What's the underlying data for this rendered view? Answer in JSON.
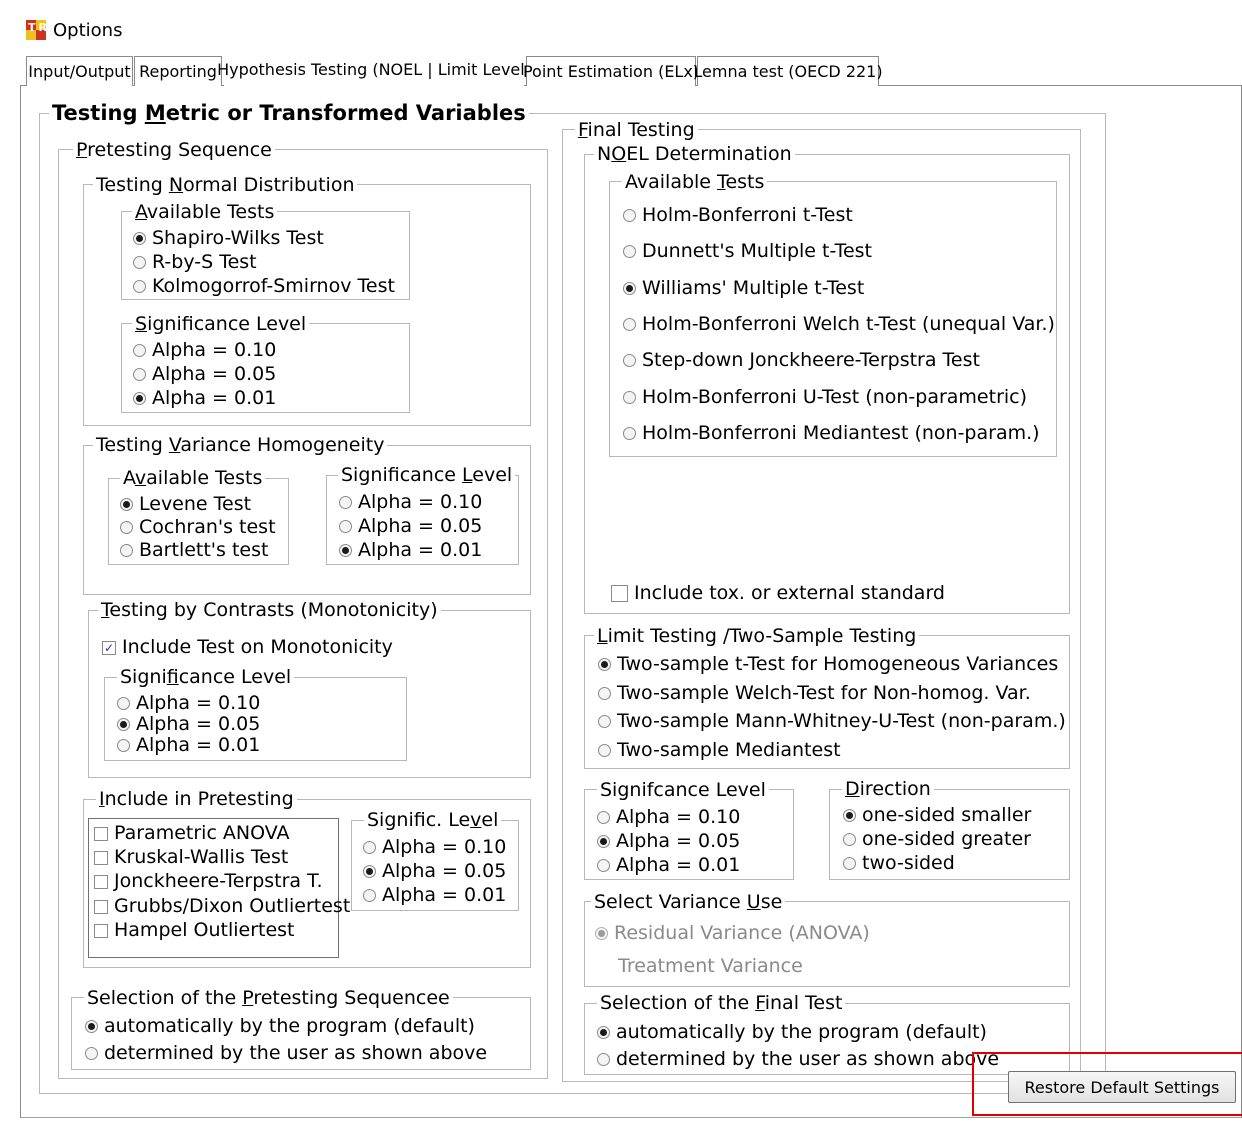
{
  "window": {
    "title": "Options",
    "logo_text": "TR"
  },
  "tabs": [
    {
      "label": "Input/Output",
      "active": false
    },
    {
      "label": "Reporting",
      "active": false
    },
    {
      "label": "Hypothesis Testing (NOEL | Limit Level)",
      "active": true
    },
    {
      "label": "Point Estimation (ELx)",
      "active": false
    },
    {
      "label": "Lemna test (OECD 221)",
      "active": false
    }
  ],
  "left": {
    "title": "Testing Metric or Transformed Variables",
    "pretesting": {
      "title": "Pretesting Sequence",
      "normal": {
        "title": "Testing Normal Distribution",
        "tests_title": "Available Tests",
        "tests": [
          "Shapiro-Wilks Test",
          "R-by-S Test",
          "Kolmogorrof-Smirnov Test"
        ],
        "selected_test": 0,
        "sig_title": "Significance Level",
        "sig": [
          "Alpha = 0.10",
          "Alpha = 0.05",
          "Alpha = 0.01"
        ],
        "selected_sig": 2
      },
      "variance": {
        "title": "Testing Variance Homogeneity",
        "tests_title": "Available Tests",
        "tests": [
          "Levene Test",
          "Cochran's test",
          "Bartlett's test"
        ],
        "selected_test": 0,
        "sig_title": "Significance Level",
        "sig": [
          "Alpha = 0.10",
          "Alpha = 0.05",
          "Alpha = 0.01"
        ],
        "selected_sig": 2
      },
      "contrasts": {
        "title": "Testing by Contrasts (Monotonicity)",
        "include_label": "Include Test on Monotonicity",
        "include_checked": true,
        "sig_title": "Significance Level",
        "sig": [
          "Alpha = 0.10",
          "Alpha = 0.05",
          "Alpha = 0.01"
        ],
        "selected_sig": 1
      },
      "include": {
        "title": "Include in Pretesting",
        "items": [
          {
            "label": "Parametric ANOVA",
            "checked": false
          },
          {
            "label": "Kruskal-Wallis Test",
            "checked": false
          },
          {
            "label": "Jonckheere-Terpstra T.",
            "checked": false
          },
          {
            "label": "Grubbs/Dixon Outliertest",
            "checked": false
          },
          {
            "label": "Hampel Outliertest",
            "checked": false
          }
        ],
        "sig_title": "Signific. Level",
        "sig": [
          "Alpha = 0.10",
          "Alpha = 0.05",
          "Alpha = 0.01"
        ],
        "selected_sig": 1
      }
    },
    "selection": {
      "title": "Selection of the Pretesting Sequencee",
      "options": [
        "automatically by the program (default)",
        "determined by the user as shown above"
      ],
      "selected": 0
    }
  },
  "right": {
    "title": "Final Testing",
    "noel": {
      "title": "NOEL Determination",
      "tests_title": "Available Tests",
      "tests": [
        "Holm-Bonferroni t-Test",
        "Dunnett's Multiple t-Test",
        "Williams' Multiple t-Test",
        "Holm-Bonferroni Welch t-Test (unequal Var.)",
        "Step-down Jonckheere-Terpstra Test",
        "Holm-Bonferroni U-Test (non-parametric)",
        "Holm-Bonferroni Mediantest (non-param.)"
      ],
      "selected_test": 2,
      "include_std_label": "Include tox. or external standard",
      "include_std_checked": false
    },
    "limit": {
      "title": "Limit Testing /Two-Sample Testing",
      "options": [
        "Two-sample t-Test for Homogeneous Variances",
        "Two-sample Welch-Test for Non-homog. Var.",
        "Two-sample Mann-Whitney-U-Test (non-param.)",
        "Two-sample Mediantest"
      ],
      "selected": 0
    },
    "sig": {
      "title": "Signifcance Level",
      "options": [
        "Alpha = 0.10",
        "Alpha = 0.05",
        "Alpha = 0.01"
      ],
      "selected": 1
    },
    "direction": {
      "title": "Direction",
      "options": [
        "one-sided smaller",
        "one-sided greater",
        "two-sided"
      ],
      "selected": 0
    },
    "variance_use": {
      "title": "Select Variance Use",
      "options": [
        "Residual Variance (ANOVA)",
        "Treatment Variance"
      ],
      "selected": 0
    },
    "final_sel": {
      "title": "Selection of the Final Test",
      "options": [
        "automatically by the program (default)",
        "determined by the user as shown above"
      ],
      "selected": 0
    }
  },
  "restore_button": "Restore Default Settings",
  "highlight_color": "#e00000"
}
